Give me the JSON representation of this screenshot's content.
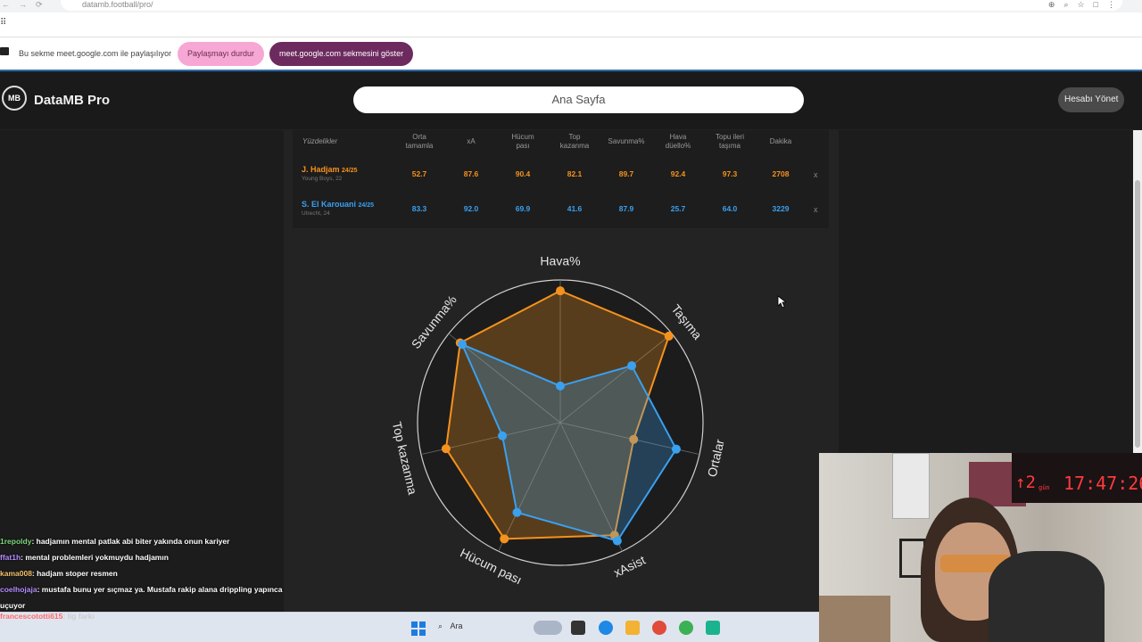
{
  "browser": {
    "url": "datamb.football/pro/",
    "share_text": "Bu sekme meet.google.com ile paylaşılıyor",
    "stop_sharing": "Paylaşmayı durdur",
    "show_tab": "meet.google.com sekmesini göster"
  },
  "app": {
    "brand": "DataMB Pro",
    "logo": "MB",
    "search_label": "Ana Sayfa",
    "manage_account": "Hesabı Yönet"
  },
  "table": {
    "first_header": "Yüzdelikler",
    "headers": [
      "Orta\ntamamla",
      "xA",
      "Hücum\npası",
      "Top\nkazanma",
      "Savunma%",
      "Hava\ndüello%",
      "Topu ileri\ntaşıma",
      "Dakika"
    ],
    "rows": [
      {
        "name": "J. Hadjam",
        "season": "24/25",
        "club": "Young Boys, 22",
        "color": "#f5921e",
        "values": [
          "52.7",
          "87.6",
          "90.4",
          "82.1",
          "89.7",
          "92.4",
          "97.3",
          "2708"
        ],
        "remove": "x"
      },
      {
        "name": "S. El Karouani",
        "season": "24/25",
        "club": "Utrecht, 24",
        "color": "#3aa0f0",
        "values": [
          "83.3",
          "92.0",
          "69.9",
          "41.6",
          "87.9",
          "25.7",
          "64.0",
          "3229"
        ],
        "remove": "x"
      }
    ]
  },
  "chart_data": {
    "type": "radar",
    "axes": [
      "Hava%",
      "Taşıma",
      "Ortalar",
      "xAsist",
      "Hücum pası",
      "Top kazanma",
      "Savunma%"
    ],
    "rlim": [
      0,
      100
    ],
    "series": [
      {
        "name": "J. Hadjam",
        "color": "#f5921e",
        "values": [
          92.4,
          97.3,
          52.7,
          87.6,
          90.4,
          82.1,
          89.7
        ]
      },
      {
        "name": "S. El Karouani",
        "color": "#3aa0f0",
        "values": [
          25.7,
          64.0,
          83.3,
          92.0,
          69.9,
          41.6,
          87.9
        ]
      }
    ]
  },
  "chat": [
    {
      "user": "1repoldy",
      "color": "#7dd87d",
      "msg": ": hadjamın mental patlak abi biter yakında onun kariyer"
    },
    {
      "user": "ffat1h",
      "color": "#b58cff",
      "msg": ": mental problemleri yokmuydu hadjamın"
    },
    {
      "user": "kama008",
      "color": "#f5c16c",
      "msg": ": hadjam stoper resmen"
    },
    {
      "user": "coelhojaja",
      "color": "#b58cff",
      "msg": ": mustafa bunu yer sıçmaz ya. Mustafa rakip alana drippling yapınca"
    },
    {
      "user": "",
      "color": "#ffffff",
      "msg": "uçuyor"
    }
  ],
  "chat_bottom": {
    "user": "francescototti615",
    "msg": ": lig farkı"
  },
  "taskbar": {
    "search": "Ara"
  },
  "timer": {
    "days": "2",
    "gun": "gün",
    "time": "17:47:26"
  }
}
